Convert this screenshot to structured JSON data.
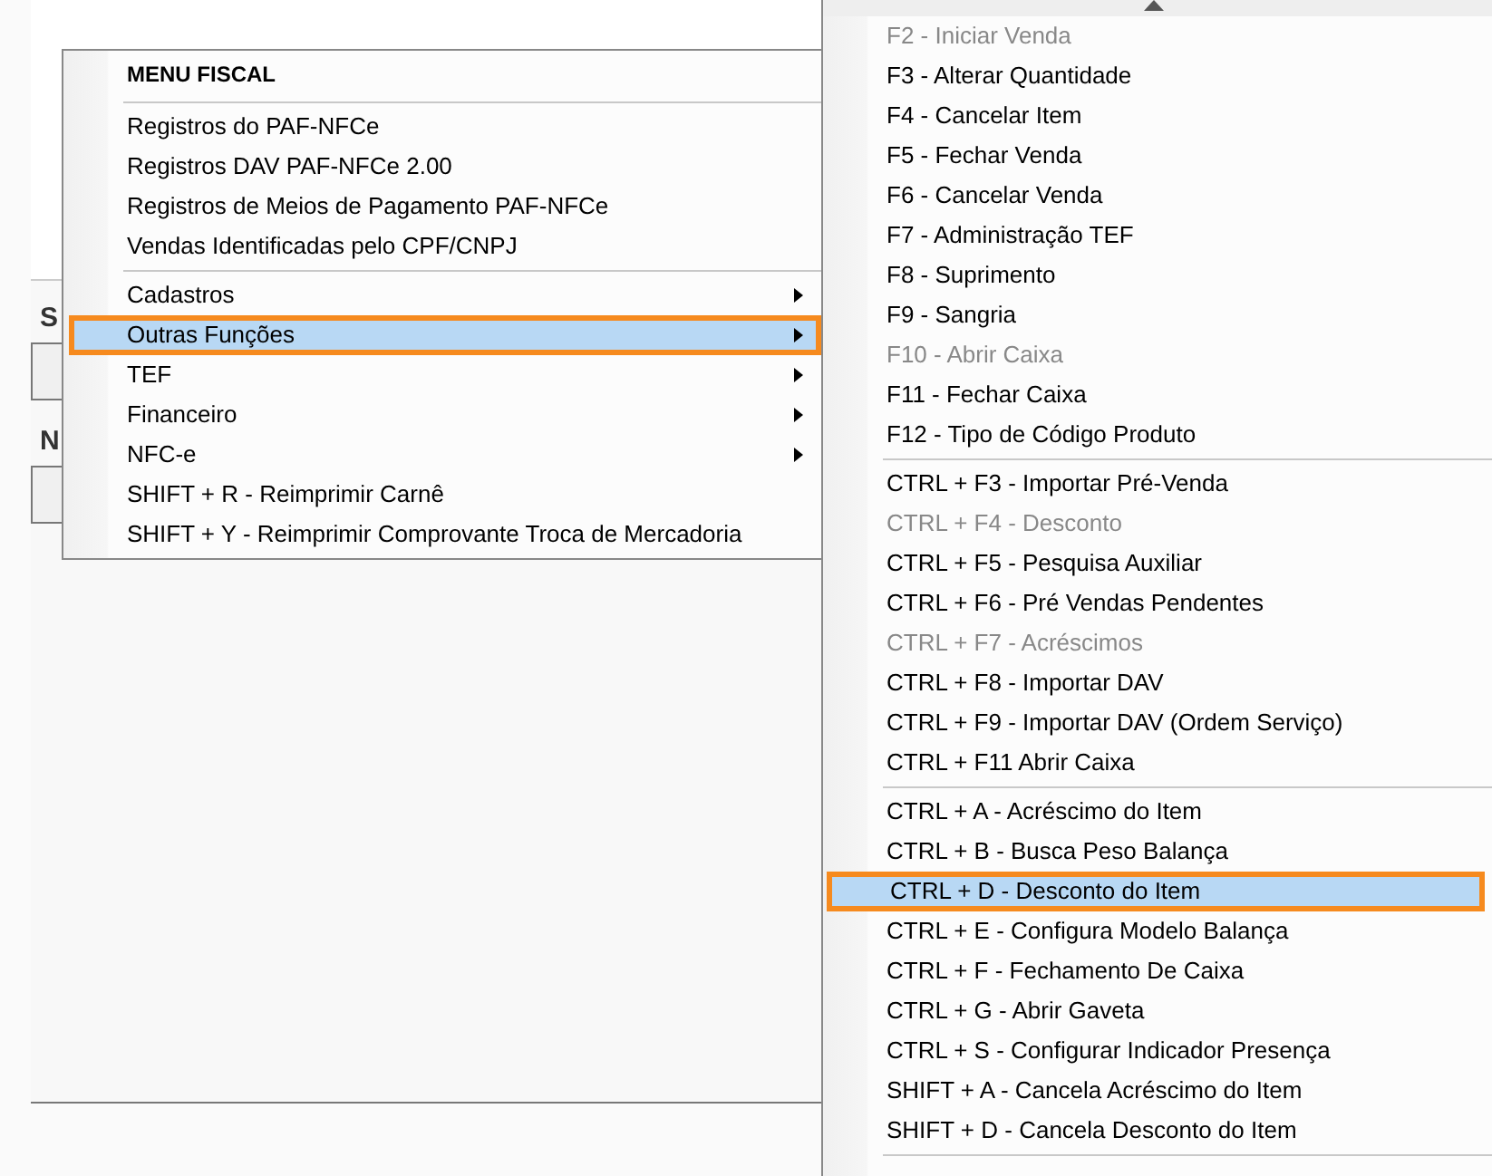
{
  "background": {
    "labels": [
      "S",
      "N"
    ]
  },
  "fiscal_menu": {
    "title": "MENU FISCAL",
    "sections": [
      {
        "items": [
          {
            "label": "Registros do PAF-NFCe",
            "submenu": false,
            "selected": false
          },
          {
            "label": "Registros DAV PAF-NFCe 2.00",
            "submenu": false,
            "selected": false
          },
          {
            "label": "Registros de Meios de Pagamento PAF-NFCe",
            "submenu": false,
            "selected": false
          },
          {
            "label": "Vendas Identificadas pelo CPF/CNPJ",
            "submenu": false,
            "selected": false
          }
        ]
      },
      {
        "items": [
          {
            "label": "Cadastros",
            "submenu": true,
            "selected": false
          },
          {
            "label": "Outras Funções",
            "submenu": true,
            "selected": true
          },
          {
            "label": "TEF",
            "submenu": true,
            "selected": false
          },
          {
            "label": "Financeiro",
            "submenu": true,
            "selected": false
          },
          {
            "label": "NFC-e",
            "submenu": true,
            "selected": false
          },
          {
            "label": "SHIFT + R - Reimprimir Carnê",
            "submenu": false,
            "selected": false
          },
          {
            "label": "SHIFT + Y - Reimprimir Comprovante Troca de Mercadoria",
            "submenu": false,
            "selected": false
          }
        ]
      }
    ]
  },
  "submenu": {
    "sections": [
      {
        "items": [
          {
            "label": "F2 - Iniciar Venda",
            "disabled": true,
            "selected": false
          },
          {
            "label": "F3 - Alterar Quantidade",
            "disabled": false,
            "selected": false
          },
          {
            "label": "F4 - Cancelar Item",
            "disabled": false,
            "selected": false
          },
          {
            "label": "F5 - Fechar Venda",
            "disabled": false,
            "selected": false
          },
          {
            "label": "F6 - Cancelar Venda",
            "disabled": false,
            "selected": false
          },
          {
            "label": "F7 - Administração TEF",
            "disabled": false,
            "selected": false
          },
          {
            "label": "F8 - Suprimento",
            "disabled": false,
            "selected": false
          },
          {
            "label": "F9 - Sangria",
            "disabled": false,
            "selected": false
          },
          {
            "label": "F10 - Abrir Caixa",
            "disabled": true,
            "selected": false
          },
          {
            "label": "F11 - Fechar Caixa",
            "disabled": false,
            "selected": false
          },
          {
            "label": "F12 - Tipo de Código Produto",
            "disabled": false,
            "selected": false
          }
        ]
      },
      {
        "items": [
          {
            "label": "CTRL + F3 - Importar Pré-Venda",
            "disabled": false,
            "selected": false
          },
          {
            "label": "CTRL + F4 - Desconto",
            "disabled": true,
            "selected": false
          },
          {
            "label": "CTRL + F5 - Pesquisa Auxiliar",
            "disabled": false,
            "selected": false
          },
          {
            "label": "CTRL + F6 - Pré Vendas Pendentes",
            "disabled": false,
            "selected": false
          },
          {
            "label": "CTRL + F7 - Acréscimos",
            "disabled": true,
            "selected": false
          },
          {
            "label": "CTRL + F8 - Importar DAV",
            "disabled": false,
            "selected": false
          },
          {
            "label": "CTRL + F9 - Importar DAV (Ordem Serviço)",
            "disabled": false,
            "selected": false
          },
          {
            "label": "CTRL + F11 Abrir Caixa",
            "disabled": false,
            "selected": false
          }
        ]
      },
      {
        "items": [
          {
            "label": "CTRL + A - Acréscimo do Item",
            "disabled": false,
            "selected": false
          },
          {
            "label": "CTRL + B - Busca Peso Balança",
            "disabled": false,
            "selected": false
          },
          {
            "label": "CTRL + D - Desconto do Item",
            "disabled": false,
            "selected": true
          },
          {
            "label": "CTRL + E - Configura Modelo Balança",
            "disabled": false,
            "selected": false
          },
          {
            "label": "CTRL + F - Fechamento De Caixa",
            "disabled": false,
            "selected": false
          },
          {
            "label": "CTRL + G - Abrir Gaveta",
            "disabled": false,
            "selected": false
          },
          {
            "label": "CTRL + S - Configurar Indicador Presença",
            "disabled": false,
            "selected": false
          },
          {
            "label": "SHIFT + A - Cancela Acréscimo do Item",
            "disabled": false,
            "selected": false
          },
          {
            "label": "SHIFT + D - Cancela Desconto do Item",
            "disabled": false,
            "selected": false
          }
        ]
      }
    ]
  }
}
